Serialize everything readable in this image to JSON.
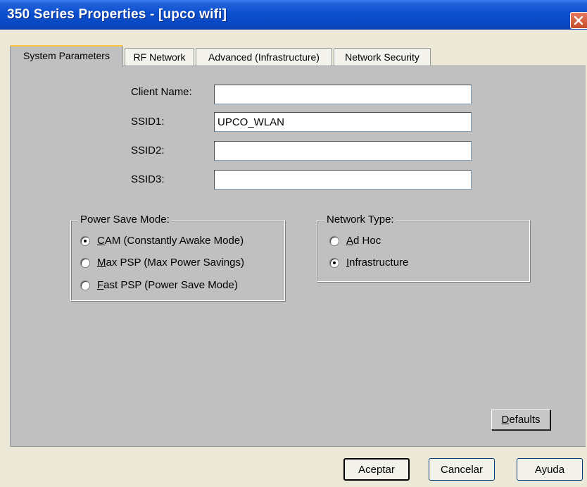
{
  "window": {
    "title": "350 Series Properties - [upco wifi]"
  },
  "tabs": [
    {
      "label": "System Parameters",
      "active": true
    },
    {
      "label": "RF Network",
      "active": false
    },
    {
      "label": "Advanced (Infrastructure)",
      "active": false
    },
    {
      "label": "Network Security",
      "active": false
    }
  ],
  "fields": {
    "client_name": {
      "label": "Client Name:",
      "value": ""
    },
    "ssid1": {
      "label": "SSID1:",
      "value": "UPCO_WLAN"
    },
    "ssid2": {
      "label": "SSID2:",
      "value": ""
    },
    "ssid3": {
      "label": "SSID3:",
      "value": ""
    }
  },
  "power_save": {
    "legend": "Power Save Mode:",
    "options": [
      {
        "mnemonic": "C",
        "rest": "AM (Constantly Awake Mode)",
        "selected": true
      },
      {
        "mnemonic": "M",
        "rest": "ax PSP (Max Power Savings)",
        "selected": false
      },
      {
        "mnemonic": "F",
        "rest": "ast PSP (Power Save Mode)",
        "selected": false
      }
    ]
  },
  "network_type": {
    "legend": "Network Type:",
    "options": [
      {
        "mnemonic": "A",
        "rest": "d Hoc",
        "selected": false
      },
      {
        "mnemonic": "I",
        "rest": "nfrastructure",
        "selected": true
      }
    ]
  },
  "buttons": {
    "defaults_mnemonic": "D",
    "defaults_rest": "efaults",
    "ok": "Aceptar",
    "cancel": "Cancelar",
    "help": "Ayuda"
  },
  "colors": {
    "titlebar": "#0A4FCF",
    "panel": "#C0C0C0",
    "dialog": "#ECE9D8",
    "close": "#C64A2A"
  }
}
